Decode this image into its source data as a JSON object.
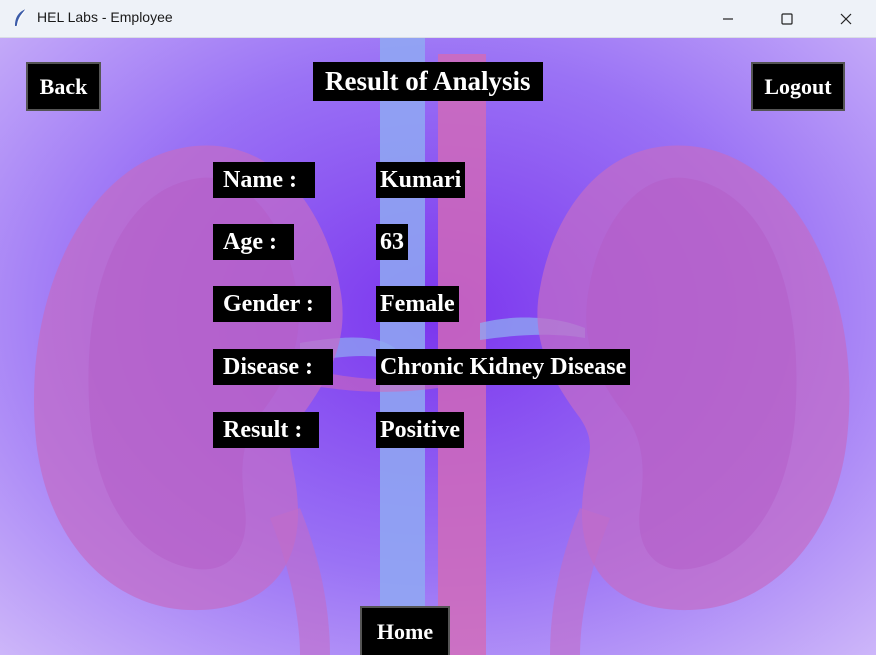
{
  "window": {
    "title": "HEL Labs - Employee"
  },
  "header": {
    "title": "Result of Analysis",
    "back_label": "Back",
    "logout_label": "Logout"
  },
  "fields": [
    {
      "label": "Name :",
      "value": "Kumari"
    },
    {
      "label": "Age :",
      "value": "63"
    },
    {
      "label": "Gender :",
      "value": "Female"
    },
    {
      "label": "Disease :",
      "value": "Chronic Kidney Disease"
    },
    {
      "label": "Result :",
      "value": "Positive"
    }
  ],
  "footer": {
    "home_label": "Home"
  },
  "colors": {
    "background": "#7b35ee",
    "kidney": "#c26cc8",
    "vein": "#8fa9f2",
    "artery": "#d36ab6",
    "panel": "#000000"
  }
}
